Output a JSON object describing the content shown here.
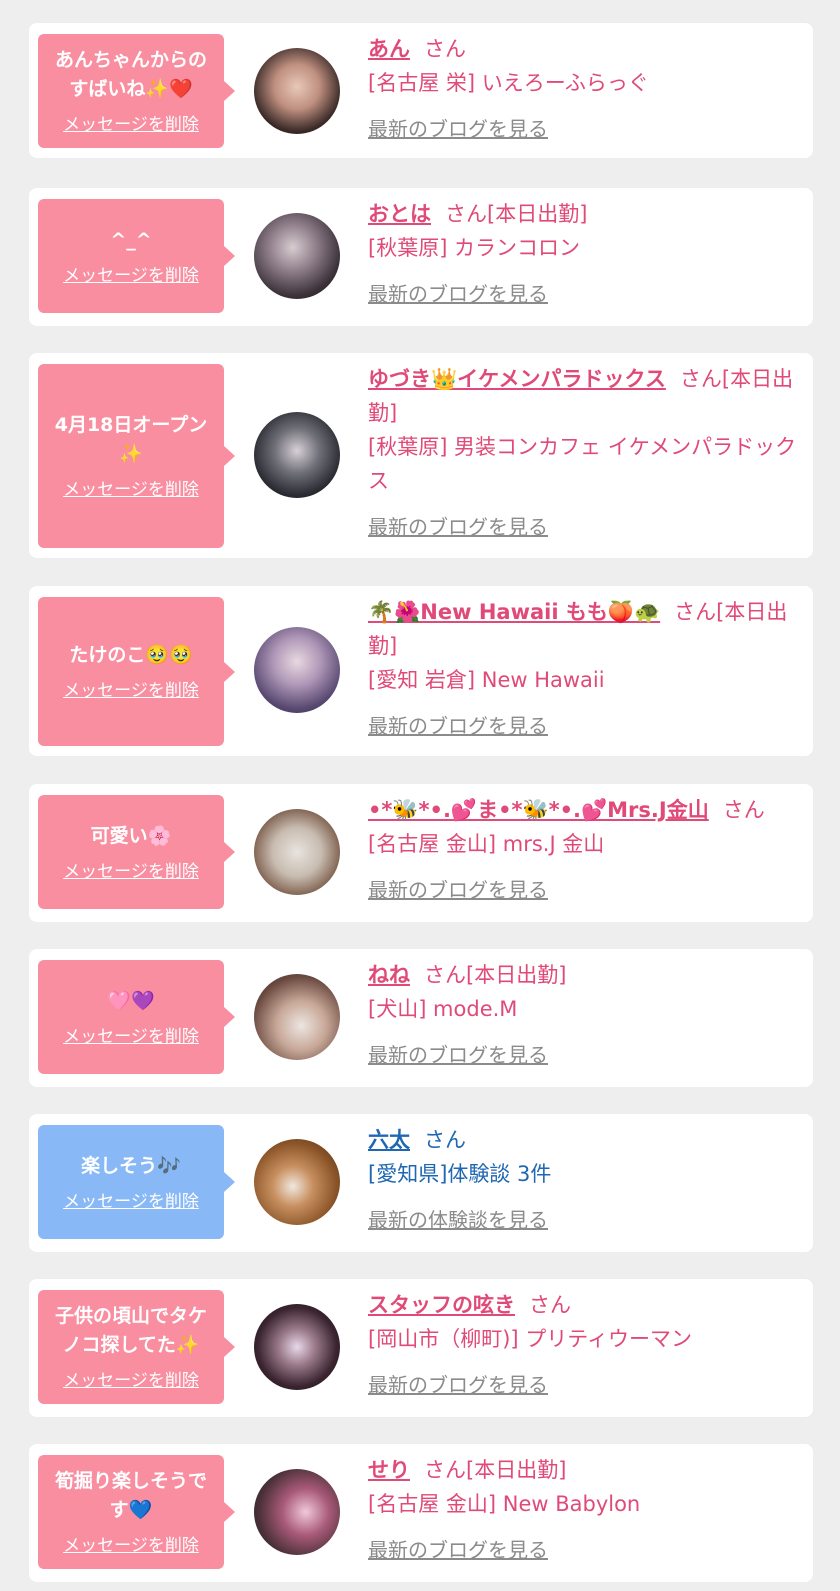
{
  "delete_label": "メッセージを削除",
  "items": [
    {
      "message": "あんちゃんからのすばいね✨❤️",
      "name": "あん",
      "suffix": "さん",
      "shop": "[名古屋 栄] いえろーふらっぐ",
      "link": "最新のブログを見る",
      "theme": "pink"
    },
    {
      "message": "^_^",
      "name": "おとは",
      "suffix": "さん[本日出勤]",
      "shop": "[秋葉原] カランコロン",
      "link": "最新のブログを見る",
      "theme": "pink"
    },
    {
      "message": "4月18日オープン✨",
      "name": "ゆづき👑イケメンパラドックス",
      "suffix": "さん[本日出勤]",
      "shop": "[秋葉原] 男装コンカフェ イケメンパラドックス",
      "link": "最新のブログを見る",
      "theme": "pink"
    },
    {
      "message": "たけのこ🥹🥹",
      "name": "🌴🌺New Hawaii もも🍑🐢",
      "suffix": "さん[本日出勤]",
      "shop": "[愛知 岩倉] New Hawaii",
      "link": "最新のブログを見る",
      "theme": "pink"
    },
    {
      "message": "可愛い🌸",
      "name": "•*🐝*•.💕ま•*🐝*•.💕Mrs.J金山",
      "suffix": "さん",
      "shop": "[名古屋 金山] mrs.J 金山",
      "link": "最新のブログを見る",
      "theme": "pink"
    },
    {
      "message": "🩷💜",
      "name": "ねね",
      "suffix": "さん[本日出勤]",
      "shop": "[犬山] mode.M",
      "link": "最新のブログを見る",
      "theme": "pink"
    },
    {
      "message": "楽しそう🎶",
      "name": "六太",
      "suffix": "さん",
      "shop": "[愛知県]体験談 3件",
      "link": "最新の体験談を見る",
      "theme": "blue"
    },
    {
      "message": "子供の頃山でタケノコ探してた✨",
      "name": "スタッフの呟き",
      "suffix": "さん",
      "shop": "[岡山市（柳町)] プリティウーマン",
      "link": "最新のブログを見る",
      "theme": "pink"
    },
    {
      "message": "筍掘り楽しそうです💙",
      "name": "せり",
      "suffix": "さん[本日出勤]",
      "shop": "[名古屋 金山] New Babylon",
      "link": "最新のブログを見る",
      "theme": "pink"
    }
  ]
}
